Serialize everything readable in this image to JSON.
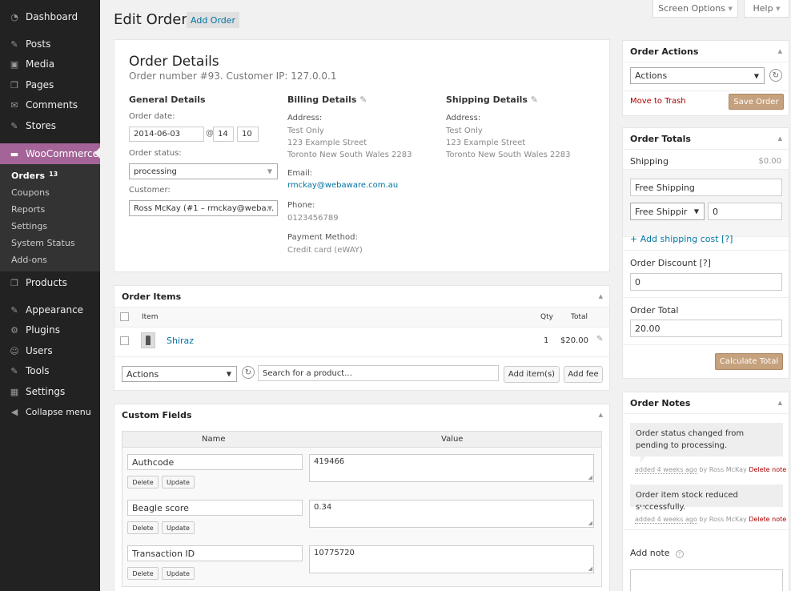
{
  "sidebar": {
    "items": [
      {
        "label": "Dashboard",
        "icon": "dashboard-icon",
        "glyph": "◔"
      },
      {
        "label": "Posts",
        "icon": "pin-icon",
        "glyph": "✎"
      },
      {
        "label": "Media",
        "icon": "media-icon",
        "glyph": "▣"
      },
      {
        "label": "Pages",
        "icon": "pages-icon",
        "glyph": "❐"
      },
      {
        "label": "Comments",
        "icon": "comments-icon",
        "glyph": "✉"
      },
      {
        "label": "Stores",
        "icon": "stores-icon",
        "glyph": "✎"
      },
      {
        "label": "WooCommerce",
        "icon": "woocommerce-icon",
        "glyph": "▬"
      },
      {
        "label": "Products",
        "icon": "products-icon",
        "glyph": "❐"
      },
      {
        "label": "Appearance",
        "icon": "appearance-icon",
        "glyph": "✎"
      },
      {
        "label": "Plugins",
        "icon": "plugins-icon",
        "glyph": "⚙"
      },
      {
        "label": "Users",
        "icon": "users-icon",
        "glyph": "☺"
      },
      {
        "label": "Tools",
        "icon": "tools-icon",
        "glyph": "✎"
      },
      {
        "label": "Settings",
        "icon": "settings-icon",
        "glyph": "▦"
      },
      {
        "label": "Collapse menu",
        "icon": "collapse-icon",
        "glyph": "◀"
      }
    ],
    "submenu": [
      {
        "label": "Orders",
        "badge": "13"
      },
      {
        "label": "Coupons"
      },
      {
        "label": "Reports"
      },
      {
        "label": "Settings"
      },
      {
        "label": "System Status"
      },
      {
        "label": "Add-ons"
      }
    ]
  },
  "topbar": {
    "screen_options": "Screen Options",
    "help": "Help"
  },
  "header": {
    "title": "Edit Order",
    "add_order": "Add Order"
  },
  "order_details": {
    "title": "Order Details",
    "subtitle": "Order number #93. Customer IP: 127.0.0.1",
    "general": {
      "heading": "General Details",
      "date_label": "Order date:",
      "date": "2014-06-03",
      "at": "@",
      "hour": "14",
      "minute": "10",
      "status_label": "Order status:",
      "status": "processing",
      "customer_label": "Customer:",
      "customer": "Ross McKay (#1 – rmckay@weba..."
    },
    "billing": {
      "heading": "Billing Details",
      "address_label": "Address:",
      "address": [
        "Test Only",
        "123 Example Street",
        "Toronto New South Wales 2283"
      ],
      "email_label": "Email:",
      "email": "rmckay@webaware.com.au",
      "phone_label": "Phone:",
      "phone": "0123456789",
      "payment_label": "Payment Method:",
      "payment": "Credit card (eWAY)"
    },
    "shipping": {
      "heading": "Shipping Details",
      "address_label": "Address:",
      "address": [
        "Test Only",
        "123 Example Street",
        "Toronto New South Wales 2283"
      ]
    }
  },
  "order_items": {
    "title": "Order Items",
    "columns": {
      "item": "Item",
      "qty": "Qty",
      "total": "Total"
    },
    "rows": [
      {
        "name": "Shiraz",
        "qty": "1",
        "total": "$20.00"
      }
    ],
    "actions": "Actions",
    "search_placeholder": "Search for a product...",
    "add_items": "Add item(s)",
    "add_fee": "Add fee"
  },
  "custom_fields": {
    "title": "Custom Fields",
    "name_header": "Name",
    "value_header": "Value",
    "delete": "Delete",
    "update": "Update",
    "rows": [
      {
        "name": "Authcode",
        "value": "419466"
      },
      {
        "name": "Beagle score",
        "value": "0.34"
      },
      {
        "name": "Transaction ID",
        "value": "10775720"
      }
    ]
  },
  "order_actions": {
    "title": "Order Actions",
    "select": "Actions",
    "trash": "Move to Trash",
    "save": "Save Order"
  },
  "order_totals": {
    "title": "Order Totals",
    "shipping_label": "Shipping",
    "shipping_value": "$0.00",
    "shipping_name": "Free Shipping",
    "shipping_method": "Free Shippir",
    "shipping_cost": "0",
    "add_shipping": "+ Add shipping cost [?]",
    "discount_label": "Order Discount [?]",
    "discount": "0",
    "total_label": "Order Total",
    "total": "20.00",
    "calculate": "Calculate Total"
  },
  "order_notes": {
    "title": "Order Notes",
    "notes": [
      {
        "text": "Order status changed from pending to processing.",
        "added": "added 4 weeks ago",
        "by": "by Ross McKay",
        "delete": "Delete note"
      },
      {
        "text": "Order item stock reduced successfully.",
        "added": "added 4 weeks ago",
        "by": "by Ross McKay",
        "delete": "Delete note"
      }
    ],
    "add_note": "Add note",
    "help_glyph": "?"
  },
  "colors": {
    "woo_purple": "#a46497",
    "sidebar": "#222222",
    "brown_button": "#c6a17d",
    "link": "#0074a2",
    "trash": "#a00000"
  }
}
